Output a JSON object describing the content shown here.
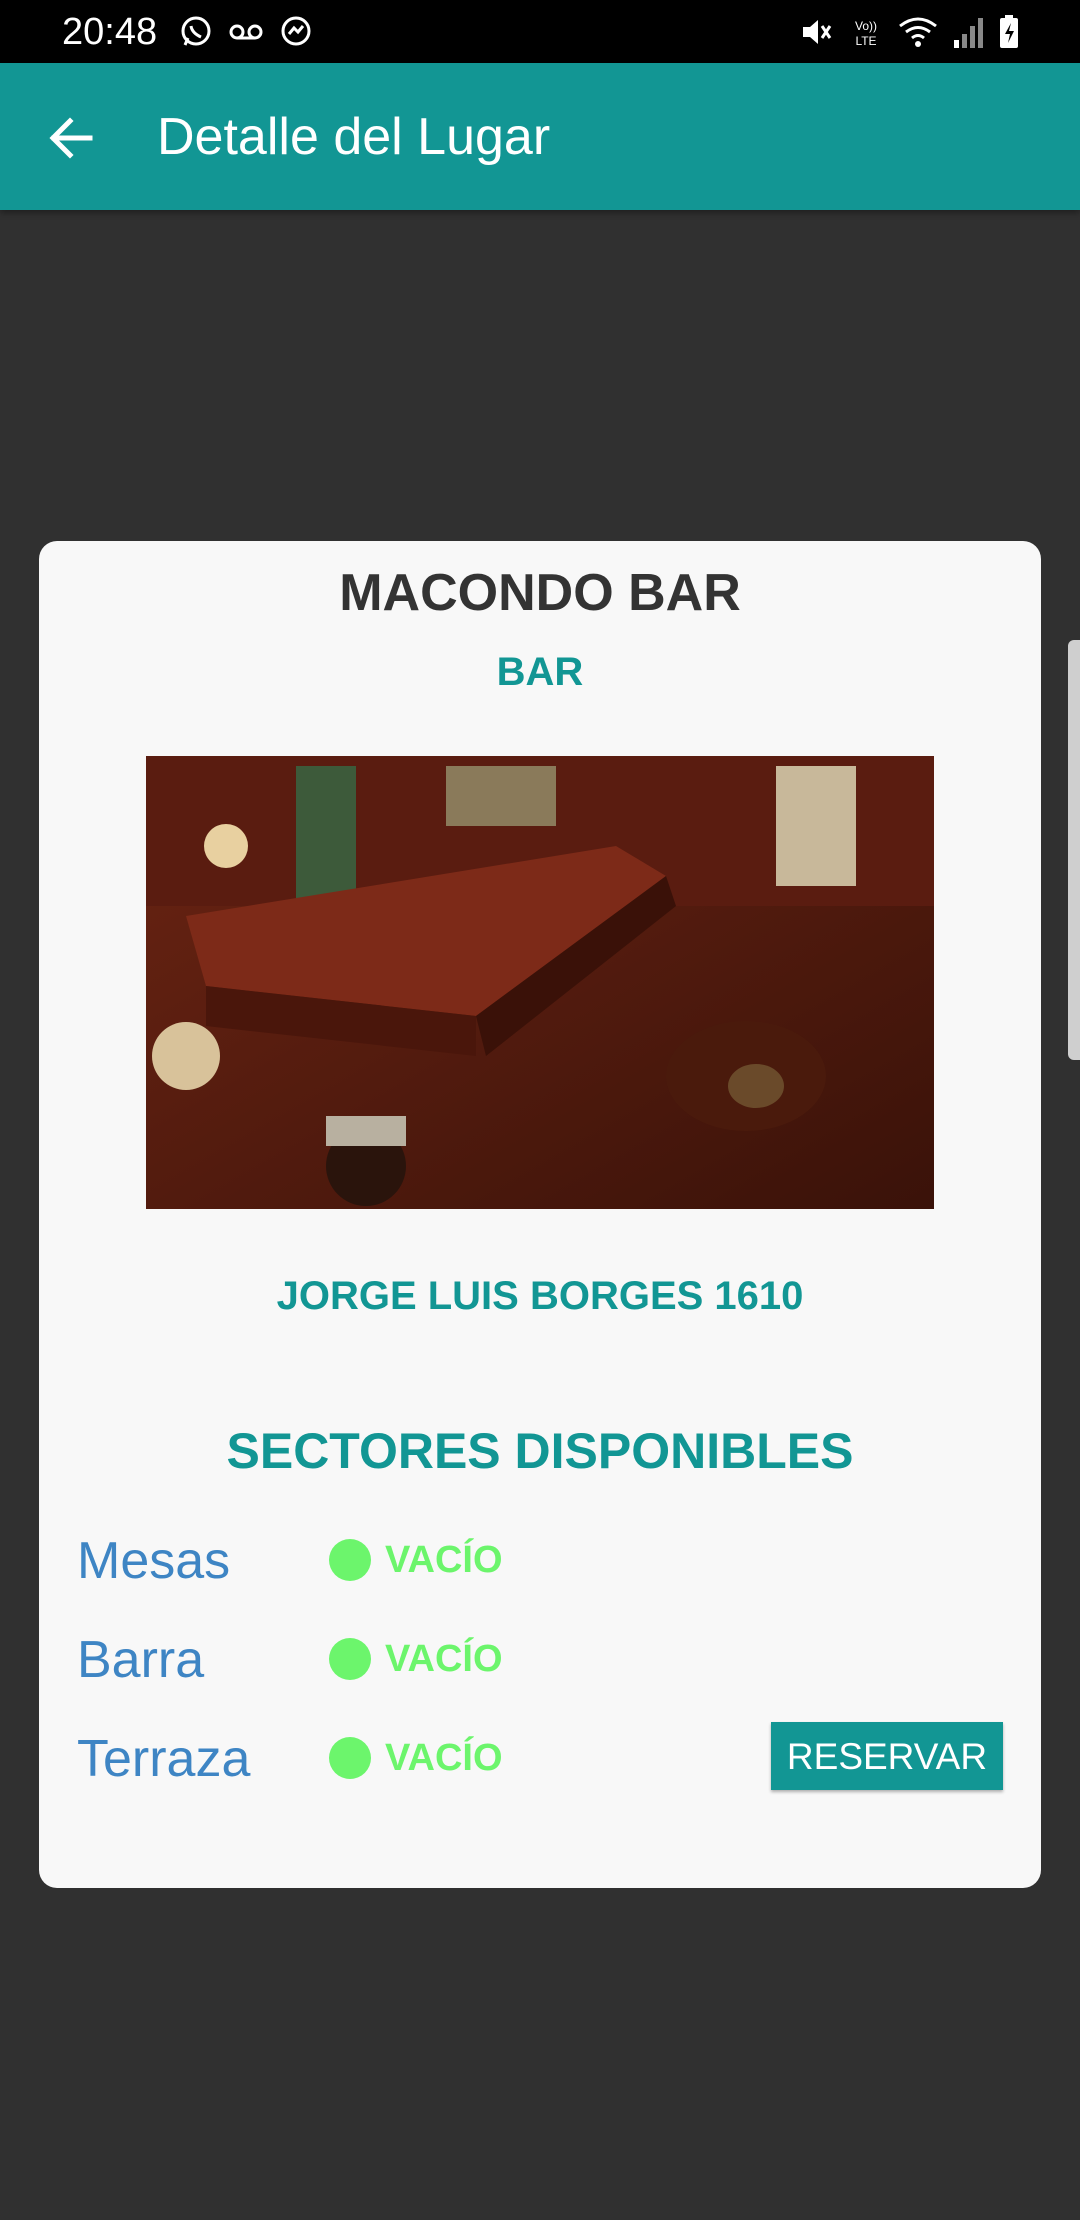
{
  "status_bar": {
    "time": "20:48",
    "left_icons": [
      "whatsapp-icon",
      "voicemail-icon",
      "messenger-icon"
    ],
    "right_icons": [
      "mute-icon",
      "volte-icon",
      "wifi-icon",
      "signal-icon",
      "battery-charging-icon"
    ],
    "volte_label": "VoLTE"
  },
  "app_bar": {
    "title": "Detalle del Lugar",
    "back_icon": "arrow-left-icon"
  },
  "place": {
    "name": "MACONDO BAR",
    "type": "BAR",
    "address": "JORGE LUIS BORGES 1610"
  },
  "sectors": {
    "title": "SECTORES DISPONIBLES",
    "items": [
      {
        "name": "Mesas",
        "status": "VACÍO"
      },
      {
        "name": "Barra",
        "status": "VACÍO"
      },
      {
        "name": "Terraza",
        "status": "VACÍO"
      }
    ]
  },
  "actions": {
    "reserve_label": "RESERVAR"
  },
  "colors": {
    "primary": "#129694",
    "background": "#303030",
    "card": "#f8f8f8",
    "status_empty": "#6cf56c",
    "sector_name": "#3e85c4"
  }
}
